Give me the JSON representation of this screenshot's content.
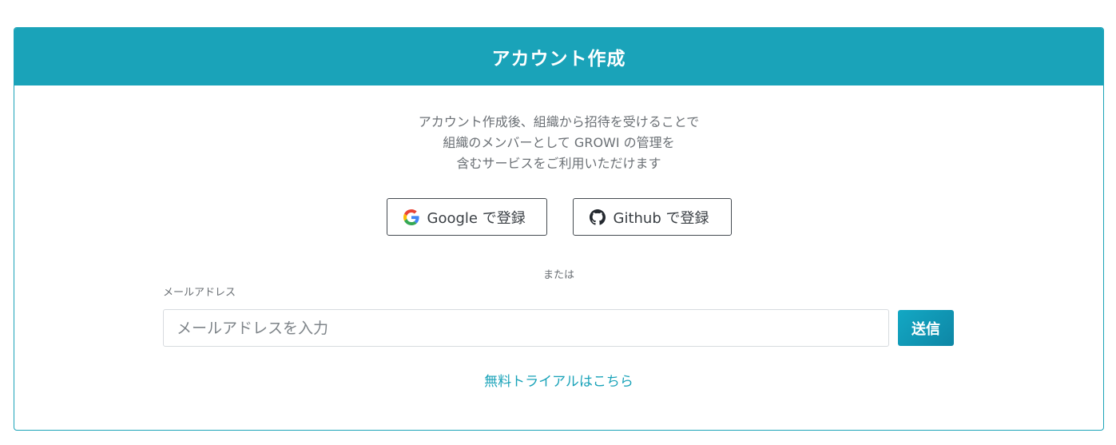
{
  "header": {
    "title": "アカウント作成"
  },
  "description": {
    "lines": [
      "アカウント作成後、組織から招待を受けることで",
      "組織のメンバーとして GROWI の管理を",
      "含むサービスをご利用いただけます"
    ]
  },
  "oauth": {
    "google": {
      "label": "Google で登録",
      "icon": "google-icon"
    },
    "github": {
      "label": "Github で登録",
      "icon": "github-icon"
    }
  },
  "divider": {
    "text": "または"
  },
  "email": {
    "label": "メールアドレス",
    "placeholder": "メールアドレスを入力",
    "value": ""
  },
  "submit": {
    "label": "送信"
  },
  "trial": {
    "label": "無料トライアルはこちら"
  },
  "colors": {
    "accent": "#1aa3b9",
    "button_gradient_start": "#13a8c4",
    "button_gradient_end": "#0e86a5"
  }
}
